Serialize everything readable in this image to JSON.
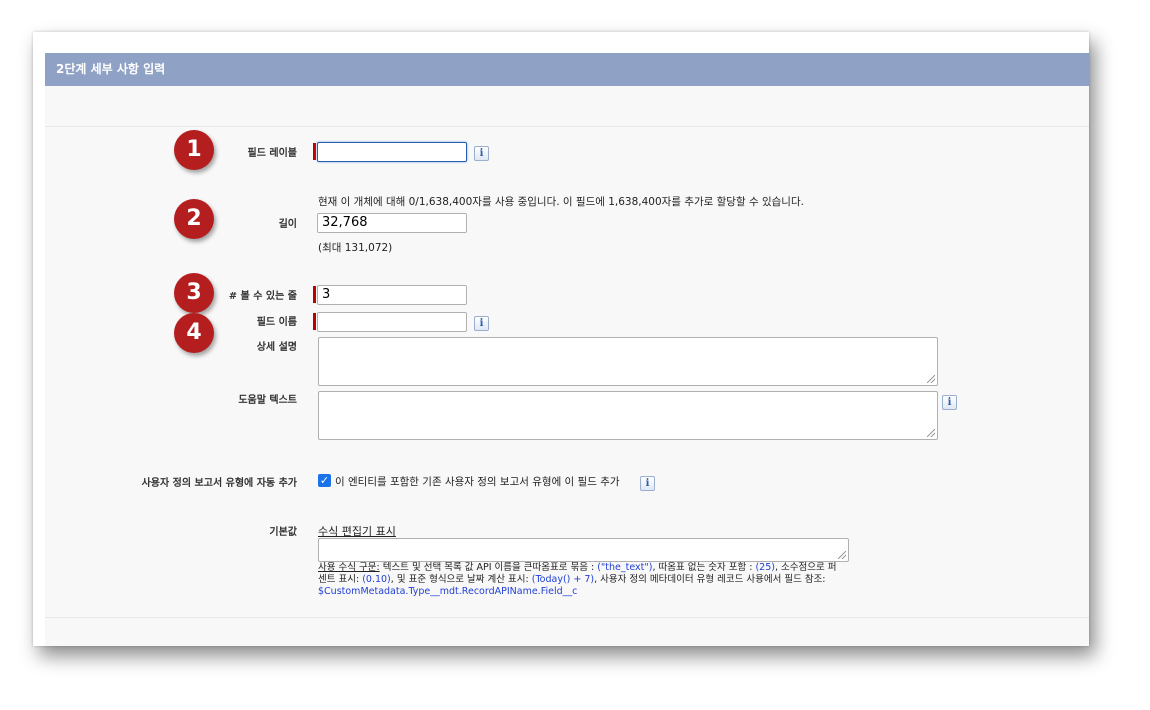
{
  "section": {
    "title": "2단계 세부 사항 입력"
  },
  "callouts": [
    "1",
    "2",
    "3",
    "4"
  ],
  "fields": {
    "label": {
      "label": "필드 레이블",
      "value": ""
    },
    "length": {
      "usage_text": "현재 이 개체에 대해 0/1,638,400자를 사용 중입니다. 이 필드에 1,638,400자를 추가로 할당할 수 있습니다.",
      "label": "길이",
      "value": "32,768",
      "max_text": "(최대 131,072)"
    },
    "visible_lines": {
      "label": "# 볼 수 있는 줄",
      "value": "3"
    },
    "name": {
      "label": "필드 이름",
      "value": ""
    },
    "description": {
      "label": "상세 설명",
      "value": ""
    },
    "help_text": {
      "label": "도움말 텍스트",
      "value": ""
    },
    "report_type": {
      "label": "사용자 정의 보고서 유형에 자동 추가",
      "checkbox_label": "이 엔티티를 포함한 기존 사용자 정의 보고서 유형에 이 필드 추가",
      "checked": true
    },
    "default_value": {
      "label": "기본값",
      "formula_link": "수식 편집기 표시",
      "value": "",
      "hint": {
        "p1_link": "사용 수식 구문:",
        "p1": " 텍스트 및 선택 목록 값 API 이름을 큰따옴표로 묶음 : ",
        "ex1": "(\"the_text\")",
        "p2": ", 따옴표 없는 숫자 포함 : ",
        "ex2": "(25)",
        "p3": ", 소수점으로 퍼",
        "p4": "센트 표시: ",
        "ex3": "(0.10)",
        "p5": ", 및 표준 형식으로 날짜 계산 표시: ",
        "ex4": "(Today() + 7)",
        "p6": ", 사용자 정의 메타데이터 유형 레코드 사용에서 필드 참조:",
        "ex5": "$CustomMetadata.Type__mdt.RecordAPIName.Field__c"
      }
    }
  },
  "icons": {
    "info": "i",
    "check": "✓"
  },
  "colors": {
    "header": "#8fa1c4",
    "badge": "#b51e1e",
    "required": "#c00000",
    "link_blue": "#1f3fd6"
  }
}
